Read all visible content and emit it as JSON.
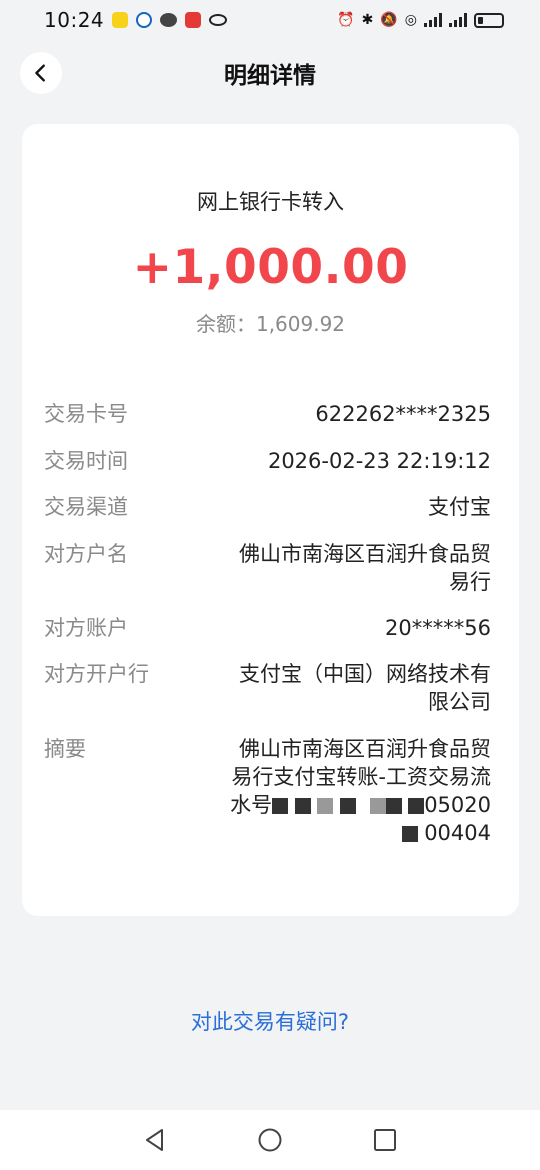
{
  "status_bar": {
    "time": "10:24",
    "network_a": "3 4G",
    "network_b": "4G"
  },
  "header": {
    "title": "明细详情"
  },
  "transaction": {
    "type": "网上银行卡转入",
    "amount": "+1,000.00",
    "balance": "余额：1,609.92",
    "amount_color": "#f0464c"
  },
  "details": [
    {
      "label": "交易卡号",
      "value": "622262****2325"
    },
    {
      "label": "交易时间",
      "value": "2026-02-23 22:19:12"
    },
    {
      "label": "交易渠道",
      "value": "支付宝"
    },
    {
      "label": "对方户名",
      "value": "佛山市南海区百润升食品贸易行"
    },
    {
      "label": "对方账户",
      "value": "20*****56"
    },
    {
      "label": "对方开户行",
      "value": "支付宝（中国）网络技术有限公司"
    },
    {
      "label": "摘要",
      "value_prefix": "佛山市南海区百润升食品贸易行支付宝转账-工资交易流水号",
      "value_mid": "05020",
      "value_tail": "00404"
    }
  ],
  "question_link": "对此交易有疑问?",
  "colors": {
    "link": "#2a6fd6",
    "label": "#8a8a8a",
    "background": "#f2f3f5"
  }
}
